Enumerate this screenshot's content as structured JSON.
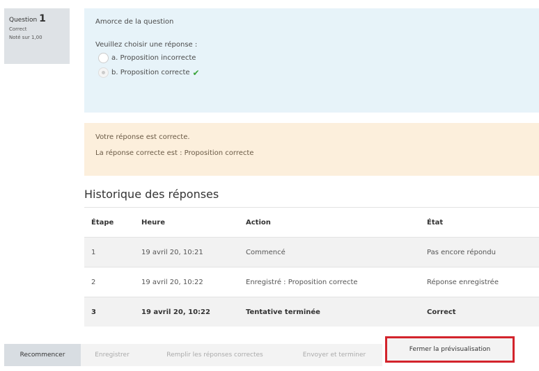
{
  "question_info": {
    "label": "Question",
    "number": "1",
    "state": "Correct",
    "grade": "Noté sur 1,00"
  },
  "formulation": {
    "question_text": "Amorce de la question",
    "prompt": "Veuillez choisir une réponse :",
    "answers": [
      {
        "label": "a. Proposition incorrecte",
        "selected": false,
        "correct": false
      },
      {
        "label": "b. Proposition correcte",
        "selected": true,
        "correct": true
      }
    ],
    "correct_icon": "checkmark-icon"
  },
  "feedback": {
    "line1": "Votre réponse est correcte.",
    "line2": "La réponse correcte est : Proposition correcte"
  },
  "history": {
    "title": "Historique des réponses",
    "columns": [
      "Étape",
      "Heure",
      "Action",
      "État"
    ],
    "rows": [
      [
        "1",
        "19 avril 20, 10:21",
        "Commencé",
        "Pas encore répondu"
      ],
      [
        "2",
        "19 avril 20, 10:22",
        "Enregistré : Proposition correcte",
        "Réponse enregistrée"
      ],
      [
        "3",
        "19 avril 20, 10:22",
        "Tentative terminée",
        "Correct"
      ]
    ]
  },
  "buttons": {
    "restart": "Recommencer",
    "save": "Enregistrer",
    "fill_correct": "Remplir les réponses correctes",
    "submit": "Envoyer et terminer",
    "close_preview": "Fermer la prévisualisation"
  },
  "colors": {
    "formulation_bg": "#e7f3f9",
    "feedback_bg": "#fcefdc",
    "highlight_border": "#d3242c",
    "correct_check": "#3aa53a"
  }
}
